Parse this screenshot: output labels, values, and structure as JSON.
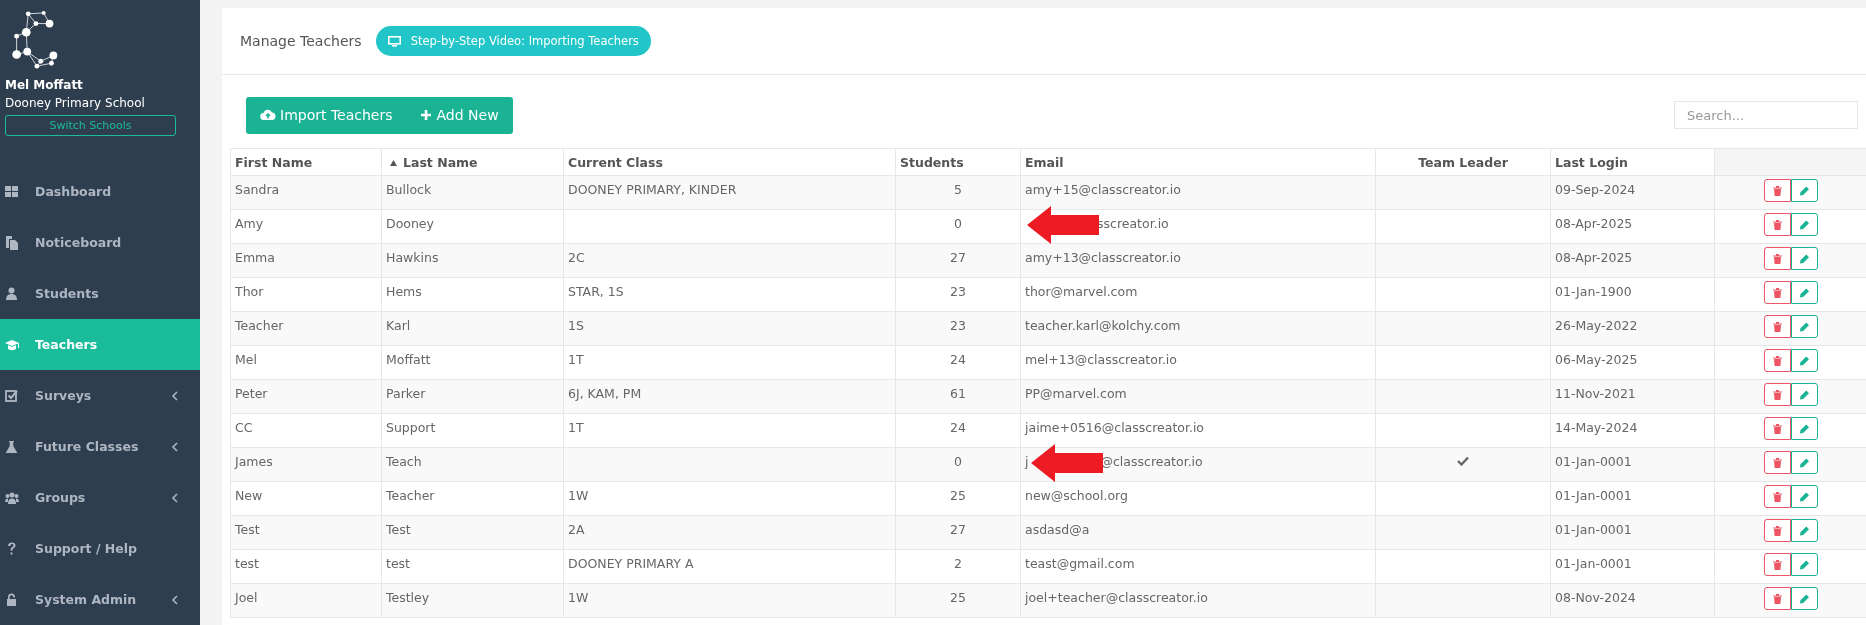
{
  "user": {
    "name": "Mel Moffatt",
    "school": "Dooney Primary School",
    "switch_button": "Switch Schools"
  },
  "nav": [
    {
      "label": "Dashboard",
      "kind": "grid",
      "selected": false,
      "submenu": false
    },
    {
      "label": "Noticeboard",
      "kind": "copy",
      "selected": false,
      "submenu": false
    },
    {
      "label": "Students",
      "kind": "user",
      "selected": false,
      "submenu": false
    },
    {
      "label": "Teachers",
      "kind": "cap",
      "selected": true,
      "submenu": false
    },
    {
      "label": "Surveys",
      "kind": "check",
      "selected": false,
      "submenu": true
    },
    {
      "label": "Future Classes",
      "kind": "flask",
      "selected": false,
      "submenu": true
    },
    {
      "label": "Groups",
      "kind": "users",
      "selected": false,
      "submenu": true
    },
    {
      "label": "Support / Help",
      "kind": "question",
      "selected": false,
      "submenu": false
    },
    {
      "label": "System Admin",
      "kind": "lock",
      "selected": false,
      "submenu": true
    }
  ],
  "page_title": "Manage Teachers",
  "video_button": "Step-by-Step Video: Importing Teachers",
  "import_button": "Import Teachers",
  "add_button": "Add New",
  "search": {
    "placeholder": "Search..."
  },
  "table": {
    "columns": [
      {
        "label": "First Name",
        "sorted": false
      },
      {
        "label": "Last Name",
        "sorted": true
      },
      {
        "label": "Current Class",
        "sorted": false
      },
      {
        "label": "Students",
        "sorted": false
      },
      {
        "label": "Email",
        "sorted": false
      },
      {
        "label": "Team Leader",
        "sorted": false
      },
      {
        "label": "Last Login",
        "sorted": false
      }
    ],
    "rows": [
      {
        "first": "Sandra",
        "last": "Bullock",
        "class": "DOONEY PRIMARY, KINDER",
        "students": "5",
        "email_before": "amy+15@classcreator.io",
        "arrow": false,
        "email_after": "",
        "team_leader": false,
        "last_login": "09-Sep-2024"
      },
      {
        "first": "Amy",
        "last": "Dooney",
        "class": "",
        "students": "0",
        "email_before": "",
        "arrow": true,
        "email_after": "sscreator.io",
        "team_leader": false,
        "last_login": "08-Apr-2025"
      },
      {
        "first": "Emma",
        "last": "Hawkins",
        "class": "2C",
        "students": "27",
        "email_before": "amy+13@classcreator.io",
        "arrow": false,
        "email_after": "",
        "team_leader": false,
        "last_login": "08-Apr-2025"
      },
      {
        "first": "Thor",
        "last": "Hems",
        "class": "STAR, 1S",
        "students": "23",
        "email_before": "thor@marvel.com",
        "arrow": false,
        "email_after": "",
        "team_leader": false,
        "last_login": "01-Jan-1900"
      },
      {
        "first": "Teacher",
        "last": "Karl",
        "class": "1S",
        "students": "23",
        "email_before": "teacher.karl@kolchy.com",
        "arrow": false,
        "email_after": "",
        "team_leader": false,
        "last_login": "26-May-2022"
      },
      {
        "first": "Mel",
        "last": "Moffatt",
        "class": "1T",
        "students": "24",
        "email_before": "mel+13@classcreator.io",
        "arrow": false,
        "email_after": "",
        "team_leader": false,
        "last_login": "06-May-2025"
      },
      {
        "first": "Peter",
        "last": "Parker",
        "class": "6J, KAM, PM",
        "students": "61",
        "email_before": "PP@marvel.com",
        "arrow": false,
        "email_after": "",
        "team_leader": false,
        "last_login": "11-Nov-2021"
      },
      {
        "first": "CC",
        "last": "Support",
        "class": "1T",
        "students": "24",
        "email_before": "jaime+0516@classcreator.io",
        "arrow": false,
        "email_after": "",
        "team_leader": false,
        "last_login": "14-May-2024"
      },
      {
        "first": "James",
        "last": "Teach",
        "class": "",
        "students": "0",
        "email_before": "j",
        "arrow": true,
        "email_after": "@classcreator.io",
        "team_leader": true,
        "last_login": "01-Jan-0001"
      },
      {
        "first": "New",
        "last": "Teacher",
        "class": "1W",
        "students": "25",
        "email_before": "new@school.org",
        "arrow": false,
        "email_after": "",
        "team_leader": false,
        "last_login": "01-Jan-0001"
      },
      {
        "first": "Test",
        "last": "Test",
        "class": "2A",
        "students": "27",
        "email_before": "asdasd@a",
        "arrow": false,
        "email_after": "",
        "team_leader": false,
        "last_login": "01-Jan-0001"
      },
      {
        "first": "test",
        "last": "test",
        "class": "DOONEY PRIMARY A",
        "students": "2",
        "email_before": "teast@gmail.com",
        "arrow": false,
        "email_after": "",
        "team_leader": false,
        "last_login": "01-Jan-0001"
      },
      {
        "first": "Joel",
        "last": "Testley",
        "class": "1W",
        "students": "25",
        "email_before": "joel+teacher@classcreator.io",
        "arrow": false,
        "email_after": "",
        "team_leader": false,
        "last_login": "08-Nov-2024"
      }
    ]
  }
}
